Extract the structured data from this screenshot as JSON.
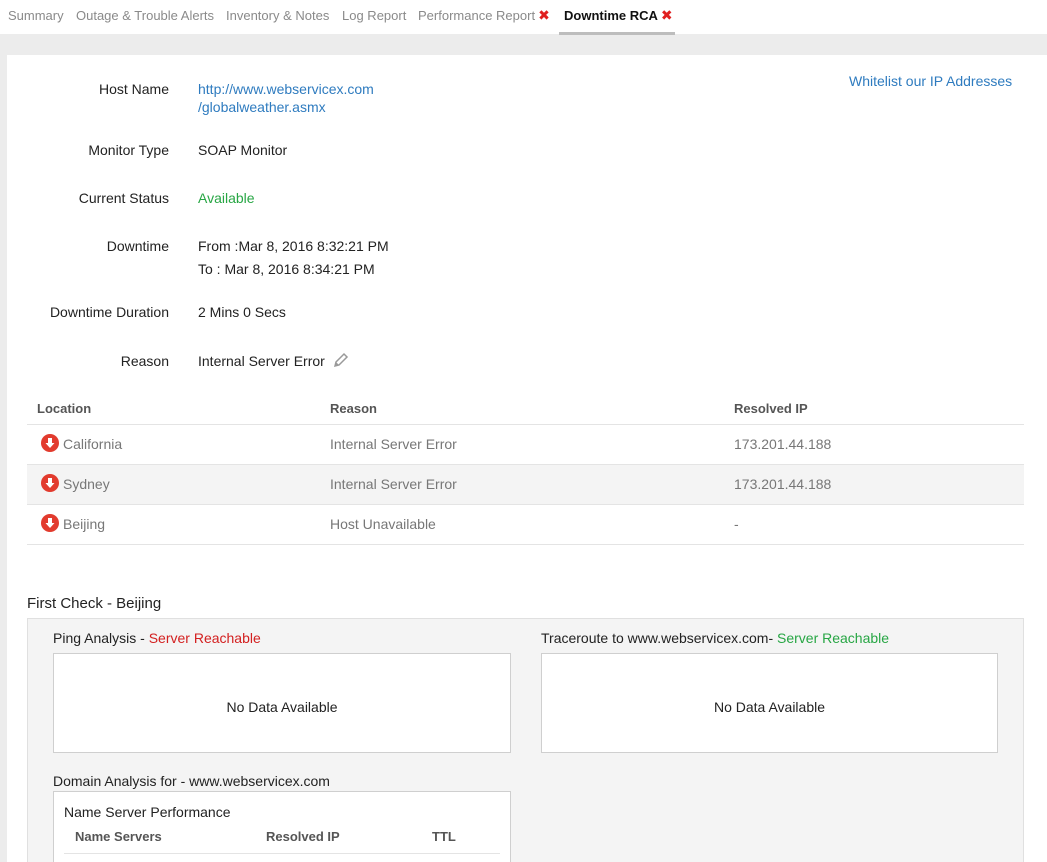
{
  "tabs": [
    {
      "label": "Summary",
      "active": false,
      "closable": false
    },
    {
      "label": "Outage & Trouble Alerts",
      "active": false,
      "closable": false
    },
    {
      "label": "Inventory & Notes",
      "active": false,
      "closable": false
    },
    {
      "label": "Log Report",
      "active": false,
      "closable": false
    },
    {
      "label": "Performance Report",
      "active": false,
      "closable": true
    },
    {
      "label": "Downtime RCA",
      "active": true,
      "closable": true
    }
  ],
  "close_glyph": "✖",
  "whitelist_link": "Whitelist our IP Addresses",
  "details": {
    "host_name_label": "Host Name",
    "host_name_line1": "http://www.webservicex.com",
    "host_name_line2": "/globalweather.asmx",
    "monitor_type_label": "Monitor Type",
    "monitor_type": "SOAP Monitor",
    "current_status_label": "Current Status",
    "current_status": "Available",
    "downtime_label": "Downtime",
    "downtime_from": "From :Mar 8, 2016 8:32:21 PM",
    "downtime_to": "To : Mar 8, 2016 8:34:21 PM",
    "duration_label": "Downtime Duration",
    "duration": "2 Mins 0 Secs",
    "reason_label": "Reason",
    "reason": "Internal Server Error"
  },
  "location_table": {
    "headers": [
      "Location",
      "Reason",
      "Resolved IP"
    ],
    "rows": [
      {
        "location": "California",
        "reason": "Internal Server Error",
        "ip": "173.201.44.188"
      },
      {
        "location": "Sydney",
        "reason": "Internal Server Error",
        "ip": "173.201.44.188"
      },
      {
        "location": "Beijing",
        "reason": "Host Unavailable",
        "ip": "-"
      }
    ]
  },
  "first_check": {
    "title": "First Check - Beijing",
    "ping_label": "Ping Analysis - ",
    "ping_status": "Server Reachable",
    "trace_label": "Traceroute to www.webservicex.com- ",
    "trace_status": "Server Reachable",
    "no_data": "No Data Available",
    "domain_label": "Domain Analysis for - www.webservicex.com",
    "ns_title": "Name Server Performance",
    "ns_headers": [
      "Name Servers",
      "Resolved IP",
      "TTL"
    ]
  },
  "colors": {
    "link": "#2e7bbf",
    "available": "#27a644",
    "unreachable": "#d32020",
    "down_icon": "#e23b2e"
  }
}
